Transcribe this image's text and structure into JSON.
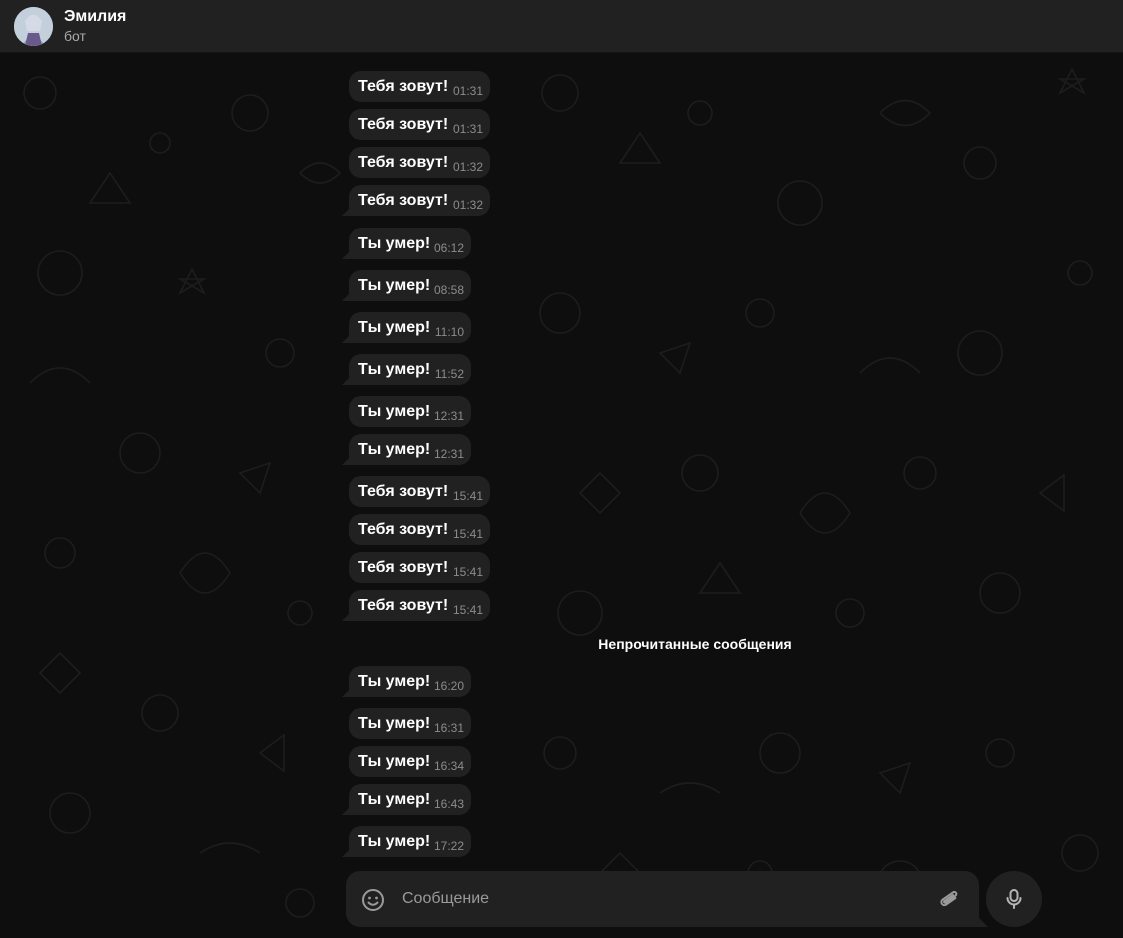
{
  "header": {
    "title": "Эмилия",
    "subtitle": "бот"
  },
  "messages": [
    {
      "text": "Тебя зовут!",
      "time": "01:31"
    },
    {
      "text": "Тебя зовут!",
      "time": "01:31"
    },
    {
      "text": "Тебя зовут!",
      "time": "01:32"
    },
    {
      "text": "Тебя зовут!",
      "time": "01:32"
    },
    {
      "text": "Ты умер!",
      "time": "06:12"
    },
    {
      "text": "Ты умер!",
      "time": "08:58"
    },
    {
      "text": "Ты умер!",
      "time": "11:10"
    },
    {
      "text": "Ты умер!",
      "time": "11:52"
    },
    {
      "text": "Ты умер!",
      "time": "12:31"
    },
    {
      "text": "Ты умер!",
      "time": "12:31"
    },
    {
      "text": "Тебя зовут!",
      "time": "15:41"
    },
    {
      "text": "Тебя зовут!",
      "time": "15:41"
    },
    {
      "text": "Тебя зовут!",
      "time": "15:41"
    },
    {
      "text": "Тебя зовут!",
      "time": "15:41"
    },
    {
      "text": "Ты умер!",
      "time": "16:20"
    },
    {
      "text": "Ты умер!",
      "time": "16:31"
    },
    {
      "text": "Ты умер!",
      "time": "16:34"
    },
    {
      "text": "Ты умер!",
      "time": "16:43"
    },
    {
      "text": "Ты умер!",
      "time": "17:22"
    }
  ],
  "unread_divider": "Непрочитанные сообщения",
  "composer": {
    "placeholder": "Сообщение",
    "emoji_icon": "smiley-icon",
    "attach_icon": "paperclip-icon",
    "send_icon": "microphone-icon"
  },
  "colors": {
    "background": "#0e0e0e",
    "bubble": "#212121",
    "header": "#212121",
    "text": "#ffffff",
    "time": "#8c8c8c"
  }
}
